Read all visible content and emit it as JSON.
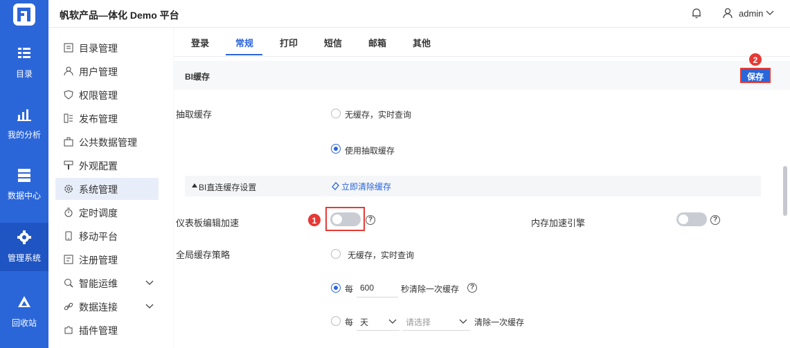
{
  "header": {
    "app_title": "帆软产品—体化 Demo 平台",
    "user_name": "admin"
  },
  "rail": {
    "items": [
      {
        "label": "目录",
        "icon": "catalog-icon"
      },
      {
        "label": "我的分析",
        "icon": "chart-icon"
      },
      {
        "label": "数据中心",
        "icon": "database-icon"
      },
      {
        "label": "管理系统",
        "icon": "gear-icon",
        "active": true
      },
      {
        "label": "回收站",
        "icon": "recycle-icon"
      }
    ]
  },
  "sidebar": {
    "items": [
      {
        "label": "目录管理",
        "icon": "list-icon"
      },
      {
        "label": "用户管理",
        "icon": "user-icon"
      },
      {
        "label": "权限管理",
        "icon": "shield-icon"
      },
      {
        "label": "发布管理",
        "icon": "publish-icon"
      },
      {
        "label": "公共数据管理",
        "icon": "briefcase-icon"
      },
      {
        "label": "外观配置",
        "icon": "brush-icon"
      },
      {
        "label": "系统管理",
        "icon": "gear-icon",
        "active": true
      },
      {
        "label": "定时调度",
        "icon": "clock-icon"
      },
      {
        "label": "移动平台",
        "icon": "mobile-icon"
      },
      {
        "label": "注册管理",
        "icon": "register-icon"
      },
      {
        "label": "智能运维",
        "icon": "maintenance-icon",
        "expandable": true
      },
      {
        "label": "数据连接",
        "icon": "link-icon",
        "expandable": true
      },
      {
        "label": "插件管理",
        "icon": "puzzle-icon"
      }
    ]
  },
  "tabs": [
    "登录",
    "常规",
    "打印",
    "短信",
    "邮箱",
    "其他"
  ],
  "active_tab": "常规",
  "section": {
    "title": "BI缓存",
    "save_label": "保存"
  },
  "extract_cache": {
    "label": "抽取缓存",
    "option_none": "无缓存，实时查询",
    "option_use": "使用抽取缓存",
    "selected": "使用抽取缓存"
  },
  "direct_cache": {
    "title": "BI直连缓存设置",
    "clear_label": "立即清除缓存"
  },
  "dashboard_accel": {
    "label": "仪表板编辑加速",
    "enabled": false
  },
  "memory_engine": {
    "label": "内存加速引擎",
    "enabled": false
  },
  "global_policy": {
    "label": "全局缓存策略",
    "option_none": "无缓存，实时查询",
    "option_every_prefix": "每",
    "every_value": "600",
    "option_every_suffix": "秒清除一次缓存",
    "option_day_prefix": "每",
    "day_unit": "天",
    "day_placeholder": "请选择",
    "option_day_suffix": "清除一次缓存",
    "selected": "seconds"
  },
  "callouts": {
    "one": "1",
    "two": "2"
  },
  "colors": {
    "primary": "#2b66d9",
    "highlight": "#e53935"
  }
}
